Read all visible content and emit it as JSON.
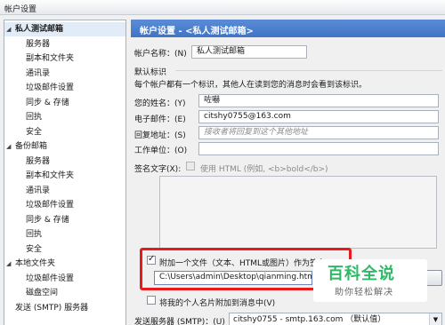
{
  "window": {
    "title": "帐户设置"
  },
  "tree": [
    {
      "label": "私人测试邮箱",
      "level": 0,
      "toggle": "◢",
      "selected": true
    },
    {
      "label": "服务器",
      "level": 1
    },
    {
      "label": "副本和文件夹",
      "level": 1
    },
    {
      "label": "通讯录",
      "level": 1
    },
    {
      "label": "垃圾邮件设置",
      "level": 1
    },
    {
      "label": "同步 & 存储",
      "level": 1
    },
    {
      "label": "回执",
      "level": 1
    },
    {
      "label": "安全",
      "level": 1
    },
    {
      "label": "备份邮箱",
      "level": 0,
      "toggle": "◢"
    },
    {
      "label": "服务器",
      "level": 1
    },
    {
      "label": "副本和文件夹",
      "level": 1
    },
    {
      "label": "通讯录",
      "level": 1
    },
    {
      "label": "垃圾邮件设置",
      "level": 1
    },
    {
      "label": "同步 & 存储",
      "level": 1
    },
    {
      "label": "回执",
      "level": 1
    },
    {
      "label": "安全",
      "level": 1
    },
    {
      "label": "本地文件夹",
      "level": 0,
      "toggle": "◢"
    },
    {
      "label": "垃圾邮件设置",
      "level": 1
    },
    {
      "label": "磁盘空间",
      "level": 1
    },
    {
      "label": "发送 (SMTP) 服务器",
      "level": 0,
      "toggle": ""
    }
  ],
  "panel": {
    "header": "帐户设置 - <私人测试邮箱>",
    "account_name_label": "帐户名称：(N)",
    "account_name_value": "私人测试邮箱",
    "default_identity_title": "默认标识",
    "identity_desc": "每个帐户都有一个标识，其他人在读到您的消息时会看到该标识。",
    "your_name_label": "您的姓名：(Y)",
    "your_name_value": "咗嚇",
    "email_label": "电子邮件：(E)",
    "email_value": "citshy0755@163.com",
    "reply_to_label": "回复地址：(S)",
    "reply_to_placeholder": "接收者将回复到这个其他地址",
    "org_label": "工作单位：(O)",
    "org_value": "",
    "sig_label": "签名文字(X):",
    "use_html_label": "使用 HTML (例如, <b>bold</b>)",
    "attach_label": "附加一个文件（文本、HTML或图片）作为签名：",
    "attach_path": "C:\\Users\\admin\\Desktop\\qianming.html",
    "vcard_label": "将我的个人名片附加到消息中(V)",
    "smtp_label": "发送服务器 (SMTP)：(U)",
    "smtp_value": "citshy0755 - smtp.163.com （默认值）"
  },
  "watermark": {
    "title": "百科全说",
    "subtitle": "助你轻松解决"
  },
  "colors": {
    "header_blue": "#3f74c6",
    "highlight_red": "#e8191f",
    "watermark_green": "#2eb867"
  }
}
